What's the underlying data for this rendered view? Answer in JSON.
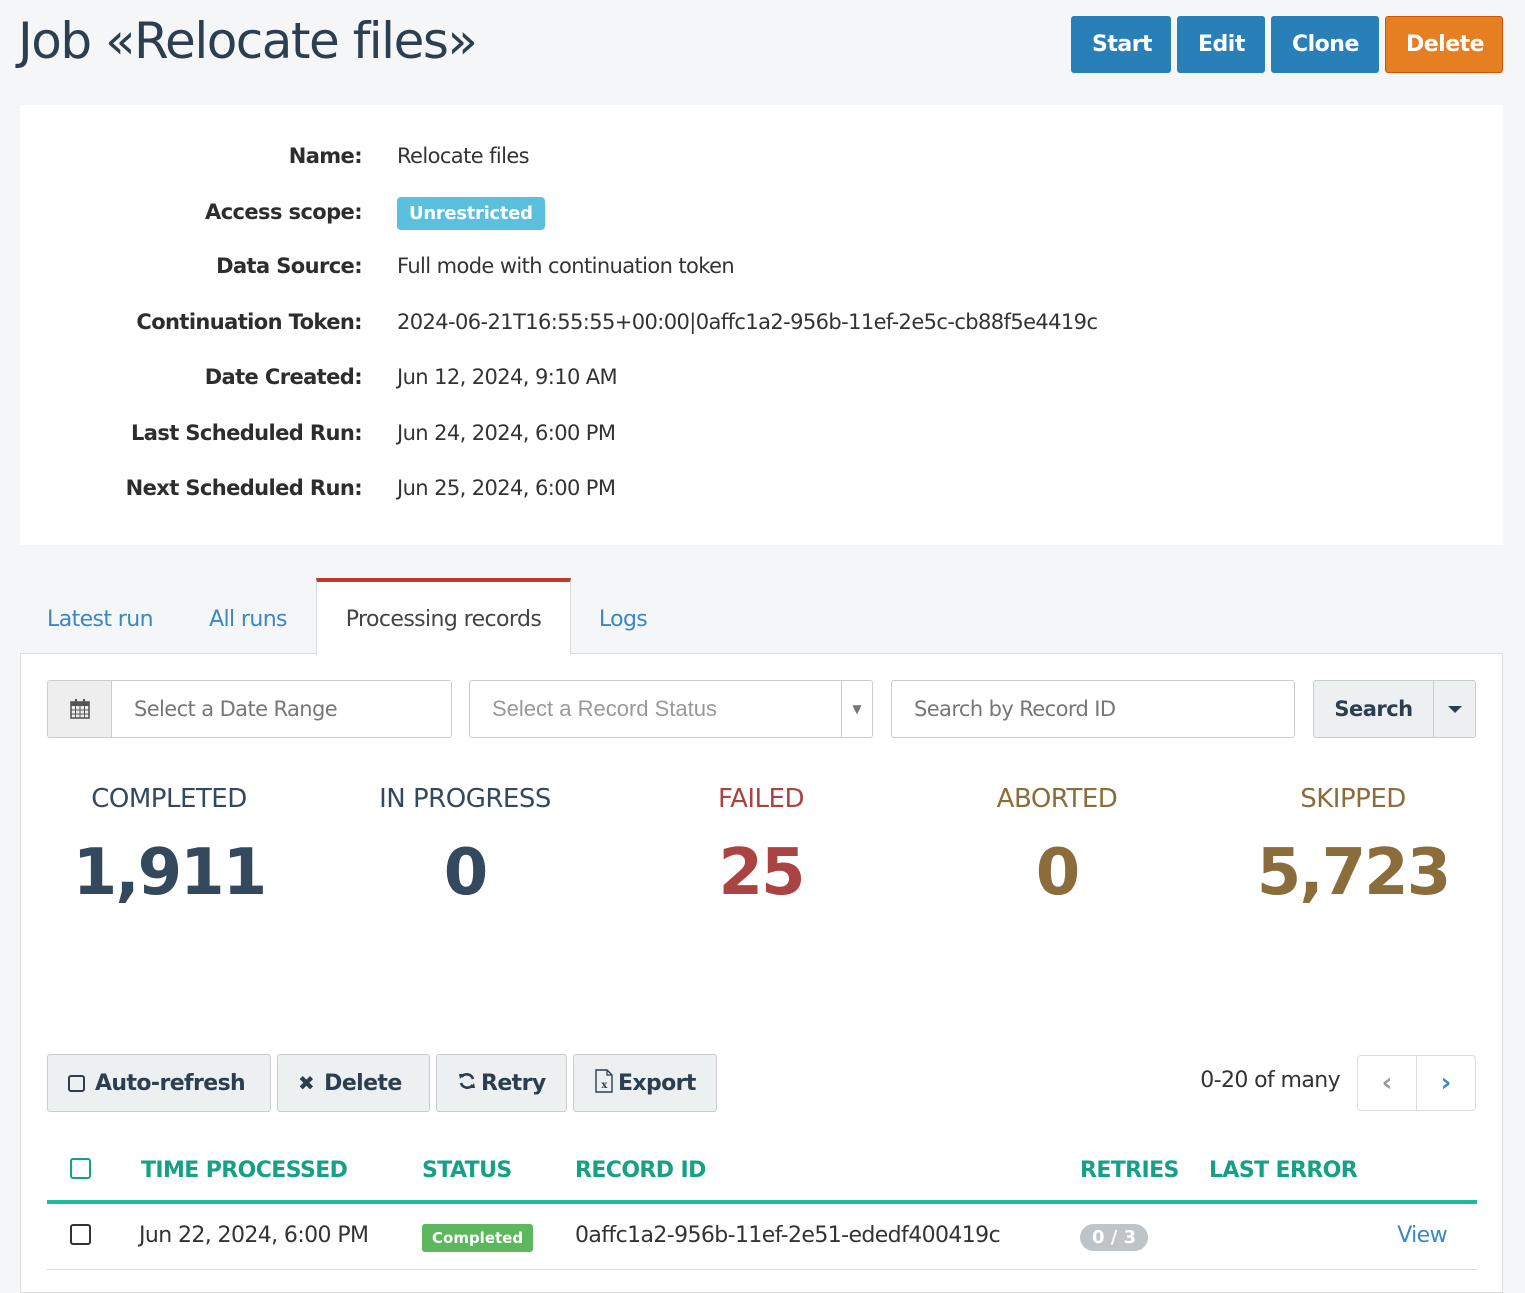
{
  "header": {
    "title": "Job «Relocate files»",
    "buttons": {
      "start": "Start",
      "edit": "Edit",
      "clone": "Clone",
      "delete": "Delete"
    }
  },
  "details": {
    "name_label": "Name:",
    "name_value": "Relocate files",
    "scope_label": "Access scope:",
    "scope_value": "Unrestricted",
    "source_label": "Data Source:",
    "source_value": "Full mode with continuation token",
    "token_label": "Continuation Token:",
    "token_value": "2024-06-21T16:55:55+00:00|0affc1a2-956b-11ef-2e5c-cb88f5e4419c",
    "created_label": "Date Created:",
    "created_value": "Jun 12, 2024, 9:10 AM",
    "last_run_label": "Last Scheduled Run:",
    "last_run_value": "Jun 24, 2024, 6:00 PM",
    "next_run_label": "Next Scheduled Run:",
    "next_run_value": "Jun 25, 2024, 6:00 PM"
  },
  "tabs": [
    {
      "label": "Latest run",
      "active": false
    },
    {
      "label": "All runs",
      "active": false
    },
    {
      "label": "Processing records",
      "active": true
    },
    {
      "label": "Logs",
      "active": false
    }
  ],
  "filters": {
    "date_placeholder": "Select a Date Range",
    "status_placeholder": "Select a Record Status",
    "search_placeholder": "Search by Record ID",
    "search_button": "Search"
  },
  "stats": [
    {
      "label": "COMPLETED",
      "value": "1,911",
      "color": "#34495e"
    },
    {
      "label": "IN PROGRESS",
      "value": "0",
      "color": "#34495e"
    },
    {
      "label": "FAILED",
      "value": "25",
      "color": "#a94442"
    },
    {
      "label": "ABORTED",
      "value": "0",
      "color": "#8a6d3b"
    },
    {
      "label": "SKIPPED",
      "value": "5,723",
      "color": "#8a6d3b"
    }
  ],
  "actions": {
    "auto_refresh": "Auto-refresh",
    "delete": "Delete",
    "retry": "Retry",
    "export": "Export"
  },
  "pagination": {
    "text": "0-20 of many"
  },
  "table": {
    "columns": [
      "TIME PROCESSED",
      "STATUS",
      "RECORD ID",
      "RETRIES",
      "LAST ERROR"
    ],
    "rows": [
      {
        "time": "Jun 22, 2024, 6:00 PM",
        "status": "Completed",
        "record_id": "0affc1a2-956b-11ef-2e51-ededf400419c",
        "retries": "0 / 3",
        "last_error": "",
        "action": "View"
      }
    ]
  }
}
